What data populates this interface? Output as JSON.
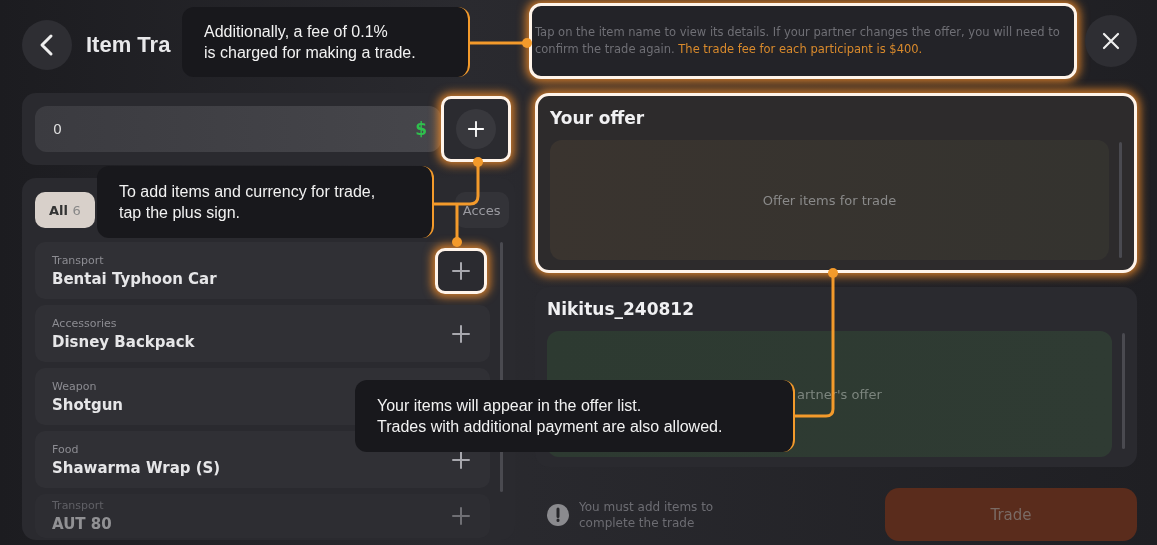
{
  "header": {
    "title": "Item Tra"
  },
  "currency": {
    "value": "0",
    "symbol": "$",
    "add_highlighted": true
  },
  "tabs": [
    {
      "label": "All",
      "count": "6",
      "selected": true
    },
    {
      "label": "Acces",
      "selected": false
    }
  ],
  "items": [
    {
      "category": "Transport",
      "name": "Bentai Typhoon Car",
      "highlighted": true
    },
    {
      "category": "Accessories",
      "name": "Disney Backpack",
      "highlighted": false
    },
    {
      "category": "Weapon",
      "name": "Shotgun"
    },
    {
      "category": "Food",
      "name": "Shawarma Wrap (S)",
      "highlighted": false
    },
    {
      "category": "Transport",
      "name": "AUT 80",
      "highlighted": false
    }
  ],
  "info": {
    "text": "Tap on the item name to view its details. If your partner changes the offer, you will need to confirm the trade again.",
    "fee_note": "The trade fee for each participant is $400.",
    "highlighted": true
  },
  "your_offer": {
    "title": "Your offer",
    "placeholder": "Offer items for trade",
    "highlighted": true
  },
  "partner_offer": {
    "title": "Nikitus_240812",
    "placeholder": "artner's offer",
    "highlighted": false
  },
  "warning": {
    "text": "You must add items to complete the trade"
  },
  "trade_button": {
    "label": "Trade",
    "disabled": true
  },
  "tooltips": [
    {
      "lines": [
        "Additionally, a fee of 0.1%",
        "is charged for making a trade."
      ]
    },
    {
      "lines": [
        "To add items and currency for trade,",
        "tap the plus sign."
      ]
    },
    {
      "lines": [
        "Your items will appear in the offer list.",
        "Trades with additional payment are also allowed."
      ]
    }
  ]
}
